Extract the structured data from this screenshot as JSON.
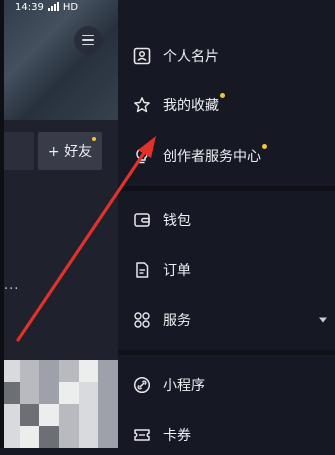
{
  "status_bar": {
    "time": "14:39",
    "network": "HD",
    "battery": "74"
  },
  "background": {
    "add_friend_label": "+ 好友",
    "more_label": "..."
  },
  "drawer": {
    "items": [
      {
        "label": "个人名片",
        "icon": "id-card-icon",
        "dot": false
      },
      {
        "label": "我的收藏",
        "icon": "star-icon",
        "dot": true
      },
      {
        "label": "创作者服务中心",
        "icon": "lightbulb-icon",
        "dot": true
      },
      {
        "label": "钱包",
        "icon": "wallet-icon",
        "dot": false
      },
      {
        "label": "订单",
        "icon": "order-icon",
        "dot": false
      },
      {
        "label": "服务",
        "icon": "grid-icon",
        "dot": false,
        "expandable": true
      },
      {
        "label": "小程序",
        "icon": "link-icon",
        "dot": false
      },
      {
        "label": "卡券",
        "icon": "coupon-icon",
        "dot": false
      }
    ]
  },
  "colors": {
    "drawer_bg": "#161823",
    "dot": "#f5c23b",
    "annotation_arrow": "#e0322b"
  }
}
